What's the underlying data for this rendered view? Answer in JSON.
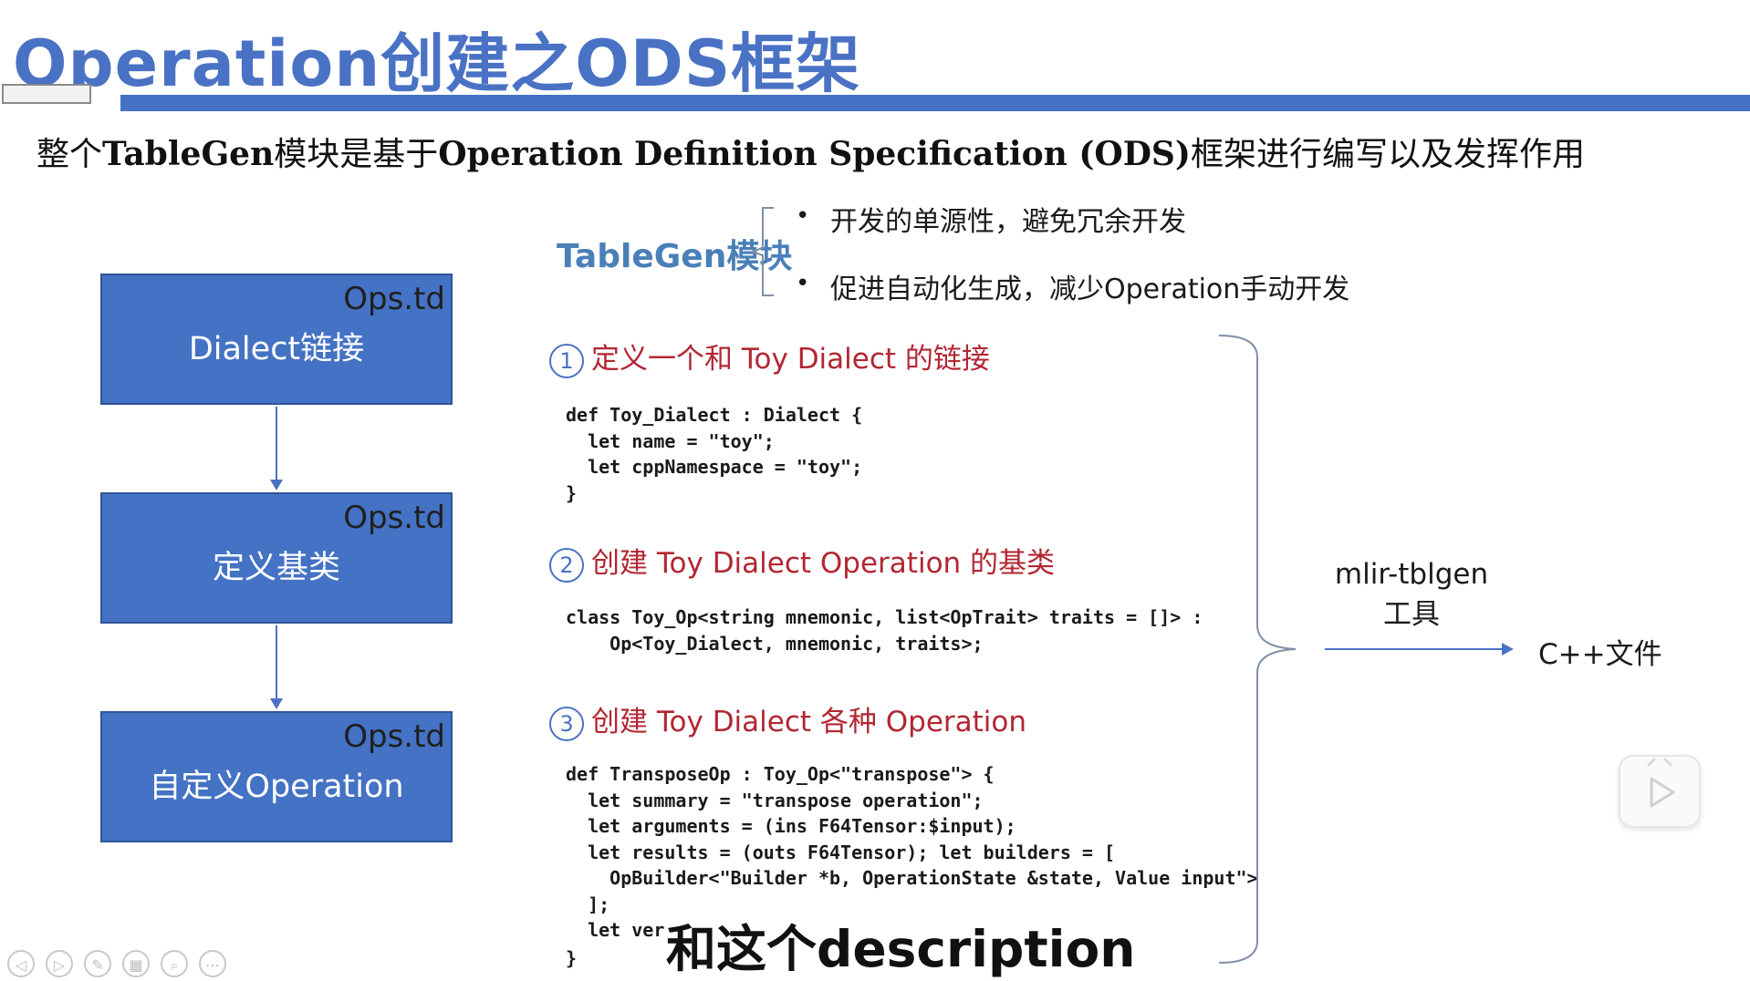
{
  "slide": {
    "title": "Operation创建之ODS框架",
    "subtitle_prefix": "整个",
    "subtitle_bold_1": "TableGen",
    "subtitle_mid": "模块是基于",
    "subtitle_bold_2": "Operation Definition Specification (ODS)",
    "subtitle_suffix": "框架进行编写以及发挥作用"
  },
  "flow": {
    "boxes": [
      {
        "tag": "Ops.td",
        "label": "Dialect链接"
      },
      {
        "tag": "Ops.td",
        "label": "定义基类"
      },
      {
        "tag": "Ops.td",
        "label": "自定义Operation"
      }
    ],
    "color": "#4472c4"
  },
  "tablegen": {
    "label": "TableGen模块",
    "bullets": [
      "开发的单源性，避免冗余开发",
      "促进自动化生成，减少Operation手动开发"
    ]
  },
  "steps": [
    {
      "num": "1",
      "title": "定义一个和 Toy Dialect 的链接",
      "code": "def Toy_Dialect : Dialect {\n  let name = \"toy\";\n  let cppNamespace = \"toy\";\n}"
    },
    {
      "num": "2",
      "title": "创建 Toy Dialect Operation 的基类",
      "code": "class Toy_Op<string mnemonic, list<OpTrait> traits = []> :\n    Op<Toy_Dialect, mnemonic, traits>;"
    },
    {
      "num": "3",
      "title": "创建 Toy Dialect 各种 Operation",
      "code": "def TransposeOp : Toy_Op<\"transpose\"> {\n  let summary = \"transpose operation\";\n  let arguments = (ins F64Tensor:$input);\n  let results = (outs F64Tensor); let builders = [\n    OpBuilder<\"Builder *b, OperationState &state, Value input\">\n  ];\n  let ver"
    }
  ],
  "code_tail": "}",
  "tool": {
    "line1": "mlir-tblgen",
    "line2": "工具"
  },
  "output": {
    "label": "C++文件"
  },
  "video": {
    "subtitle": "和这个description",
    "controls": [
      "prev-icon",
      "next-icon",
      "pen-icon",
      "grid-icon",
      "zoom-icon",
      "more-icon"
    ]
  },
  "colors": {
    "accent": "#4472c4",
    "step_red": "#b22632",
    "title_blue": "#4a72c4"
  }
}
